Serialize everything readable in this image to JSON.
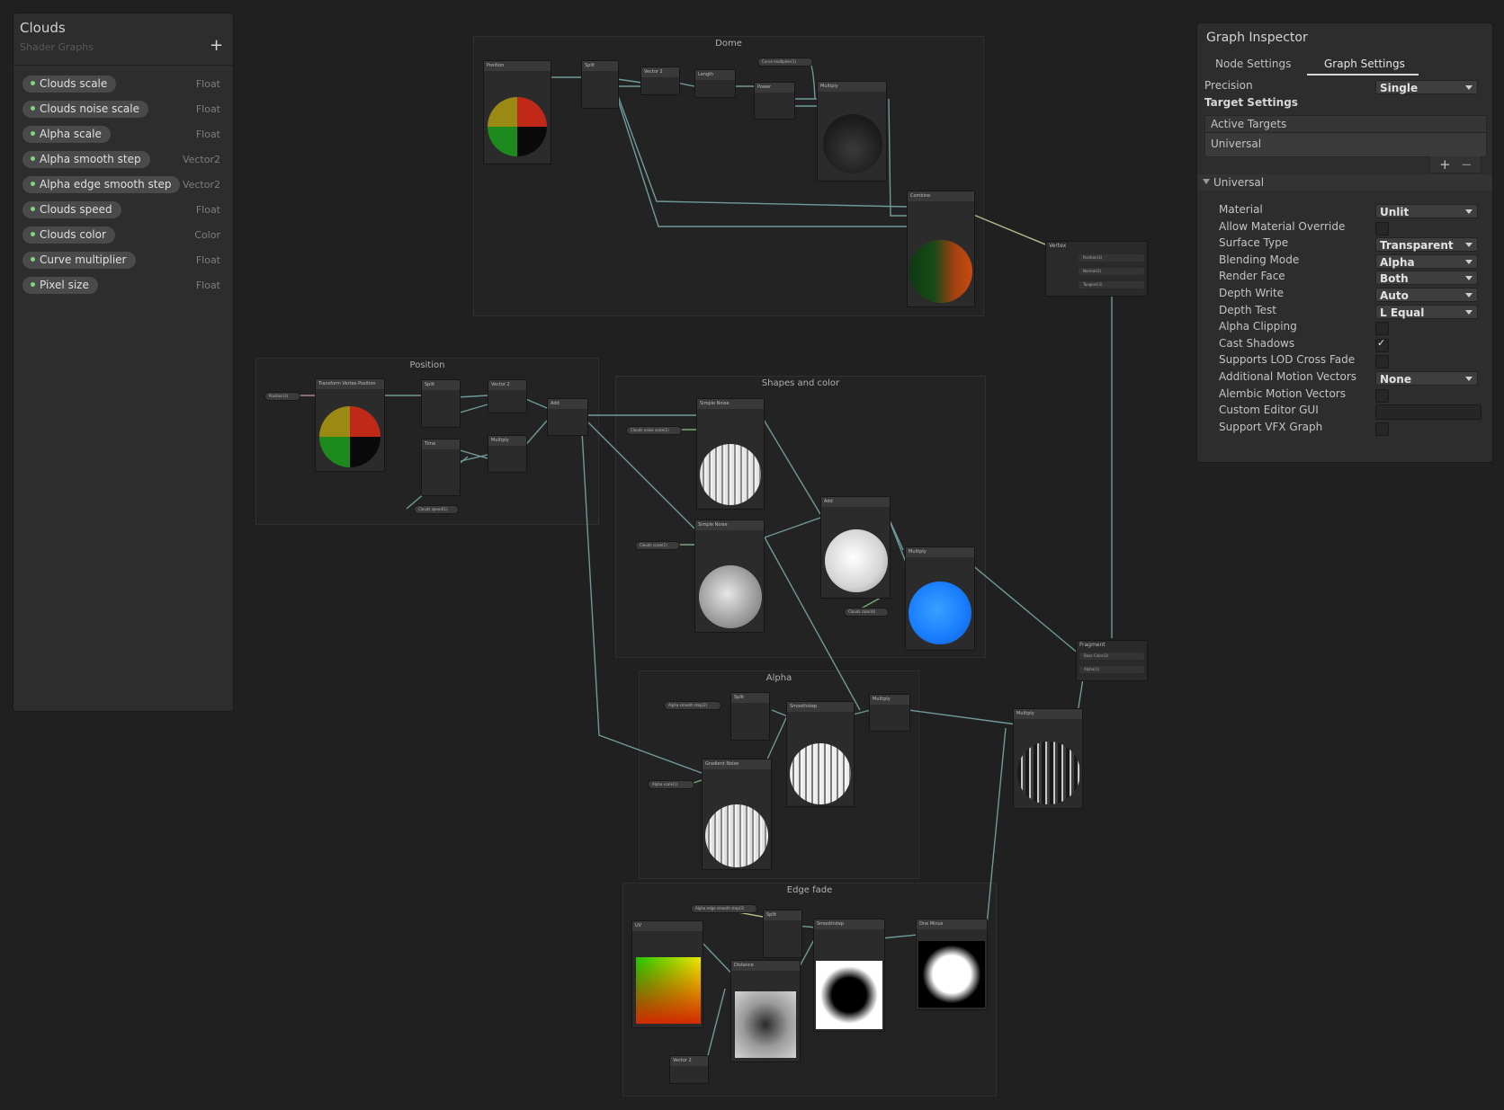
{
  "blackboard": {
    "title": "Clouds",
    "subtitle": "Shader Graphs",
    "add_label": "+",
    "properties": [
      {
        "name": "Clouds scale",
        "type": "Float"
      },
      {
        "name": "Clouds noise scale",
        "type": "Float"
      },
      {
        "name": "Alpha scale",
        "type": "Float"
      },
      {
        "name": "Alpha smooth step",
        "type": "Vector2"
      },
      {
        "name": "Alpha edge smooth step",
        "type": "Vector2"
      },
      {
        "name": "Clouds speed",
        "type": "Float"
      },
      {
        "name": "Clouds color",
        "type": "Color"
      },
      {
        "name": "Curve multiplier",
        "type": "Float"
      },
      {
        "name": "Pixel size",
        "type": "Float"
      }
    ]
  },
  "inspector": {
    "title": "Graph Inspector",
    "tabs": [
      "Node Settings",
      "Graph Settings"
    ],
    "active_tab": "Graph Settings",
    "precision_label": "Precision",
    "precision_value": "Single",
    "target_settings_label": "Target Settings",
    "active_targets_label": "Active Targets",
    "active_target_item": "Universal",
    "add_label": "+",
    "remove_label": "−",
    "universal_section": "Universal",
    "settings": [
      {
        "label": "Material",
        "kind": "dropdown",
        "value": "Unlit"
      },
      {
        "label": "Allow Material Override",
        "kind": "checkbox",
        "checked": false
      },
      {
        "label": "Surface Type",
        "kind": "dropdown",
        "value": "Transparent"
      },
      {
        "label": "Blending Mode",
        "kind": "dropdown",
        "value": "Alpha"
      },
      {
        "label": "Render Face",
        "kind": "dropdown",
        "value": "Both"
      },
      {
        "label": "Depth Write",
        "kind": "dropdown",
        "value": "Auto"
      },
      {
        "label": "Depth Test",
        "kind": "dropdown",
        "value": "L Equal"
      },
      {
        "label": "Alpha Clipping",
        "kind": "checkbox",
        "checked": false
      },
      {
        "label": "Cast Shadows",
        "kind": "checkbox",
        "checked": true
      },
      {
        "label": "Supports LOD Cross Fade",
        "kind": "checkbox",
        "checked": false
      },
      {
        "label": "Additional Motion Vectors",
        "kind": "dropdown",
        "value": "None"
      },
      {
        "label": "Alembic Motion Vectors",
        "kind": "checkbox",
        "checked": false
      },
      {
        "label": "Custom Editor GUI",
        "kind": "text",
        "value": ""
      },
      {
        "label": "Support VFX Graph",
        "kind": "checkbox",
        "checked": false
      }
    ]
  },
  "groups": {
    "dome": "Dome",
    "position": "Position",
    "shapes": "Shapes and color",
    "alpha": "Alpha",
    "edge": "Edge fade"
  },
  "contexts": {
    "vertex": {
      "title": "Vertex",
      "slots": [
        "Position(3)",
        "Normal(3)",
        "Tangent(3)"
      ]
    },
    "fragment": {
      "title": "Fragment",
      "slots": [
        "Base Color(3)",
        "Alpha(1)"
      ]
    }
  },
  "colors": {
    "background": "#202020",
    "panel": "#2d2d2d",
    "wire": "#6f9a9a",
    "wire_green": "#7aa87a",
    "wire_yellow": "#b7b98a",
    "property_dot": "#7fd87f",
    "blue_preview": "#1a7fff"
  }
}
